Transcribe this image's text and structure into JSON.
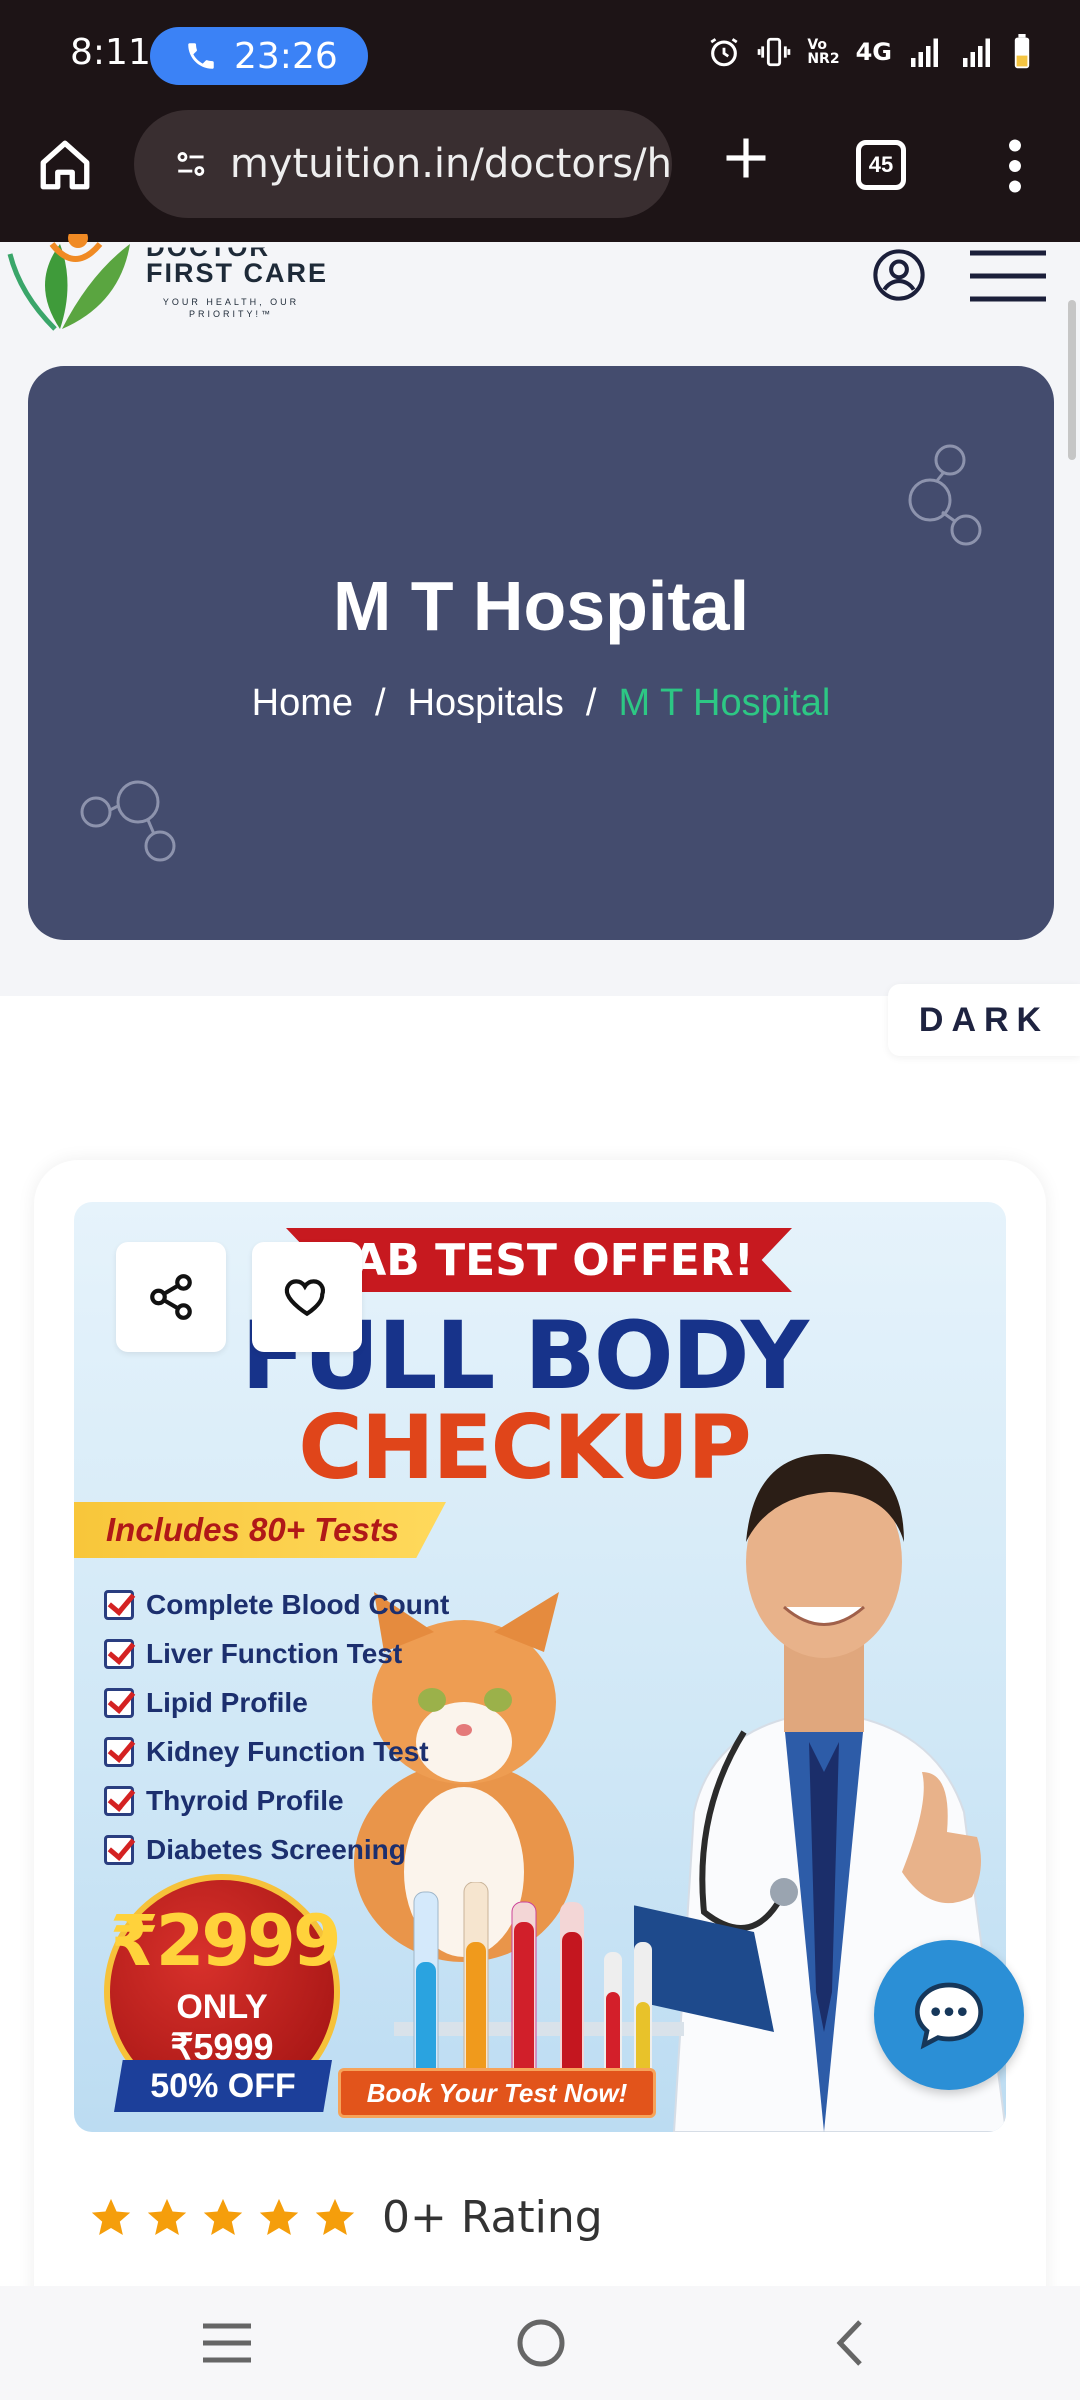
{
  "status_bar": {
    "time": "8:11",
    "call_timer": "23:26",
    "network": "4G",
    "volte": "Vo\nNR2"
  },
  "browser": {
    "url": "mytuition.in/doctors/h",
    "tab_count": "45"
  },
  "site": {
    "logo_top": "DOCTOR",
    "logo_name": "FIRST CARE",
    "logo_tagline": "YOUR HEALTH, OUR PRIORITY!™"
  },
  "hero": {
    "title": "M T Hospital",
    "breadcrumb": [
      "Home",
      "Hospitals",
      "M T Hospital"
    ],
    "separator": "/"
  },
  "theme_toggle": {
    "label": "DARK"
  },
  "banner": {
    "ribbon": "LAB TEST OFFER!",
    "headline_1": "FULL BODY",
    "headline_2": "CHECKUP",
    "includes": "Includes 80+ Tests",
    "tests": [
      "Complete Blood Count",
      "Liver Function Test",
      "Lipid Profile",
      "Kidney Function Test",
      "Thyroid Profile",
      "Diabetes Screening"
    ],
    "price": "₹2999",
    "only": "ONLY",
    "old_price": "₹5999",
    "discount": "50% OFF",
    "cta": "Book Your Test Now!"
  },
  "rating": {
    "stars": 5,
    "text": "0+ Rating",
    "star_color": "#f59e0b"
  },
  "colors": {
    "hero_bg": "#444c6e",
    "breadcrumb_active": "#2dc784",
    "chat_button": "#2b8fd6"
  }
}
